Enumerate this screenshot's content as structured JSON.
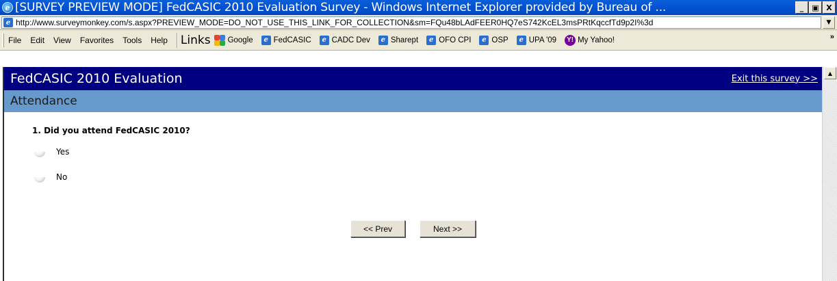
{
  "window": {
    "title": "[SURVEY PREVIEW MODE] FedCASIC 2010 Evaluation Survey - Windows Internet Explorer provided by Bureau of ...",
    "minimize_label": "_",
    "maximize_label": "▣",
    "close_label": "X"
  },
  "address": {
    "url": "http://www.surveymonkey.com/s.aspx?PREVIEW_MODE=DO_NOT_USE_THIS_LINK_FOR_COLLECTION&sm=FQu48bLAdFEER0HQ7eS742KcEL3msPRtKqccfTd9p2I%3d"
  },
  "menu": {
    "items": [
      "File",
      "Edit",
      "View",
      "Favorites",
      "Tools",
      "Help"
    ],
    "links_label": "Links",
    "links": [
      "Google",
      "FedCASIC",
      "CADC Dev",
      "Sharept",
      "OFO CPI",
      "OSP",
      "UPA '09",
      "My Yahoo!"
    ],
    "more_label": "»"
  },
  "survey": {
    "title": "FedCASIC 2010 Evaluation",
    "exit_label": "Exit this survey >>",
    "section": "Attendance",
    "question": "1. Did you attend FedCASIC 2010?",
    "options": [
      "Yes",
      "No"
    ],
    "prev_label": "<< Prev",
    "next_label": "Next >>"
  },
  "colors": {
    "header_bg": "#000080",
    "section_bg": "#6699cc",
    "titlebar_bg": "#0454d4",
    "chrome_bg": "#ece9d8"
  }
}
